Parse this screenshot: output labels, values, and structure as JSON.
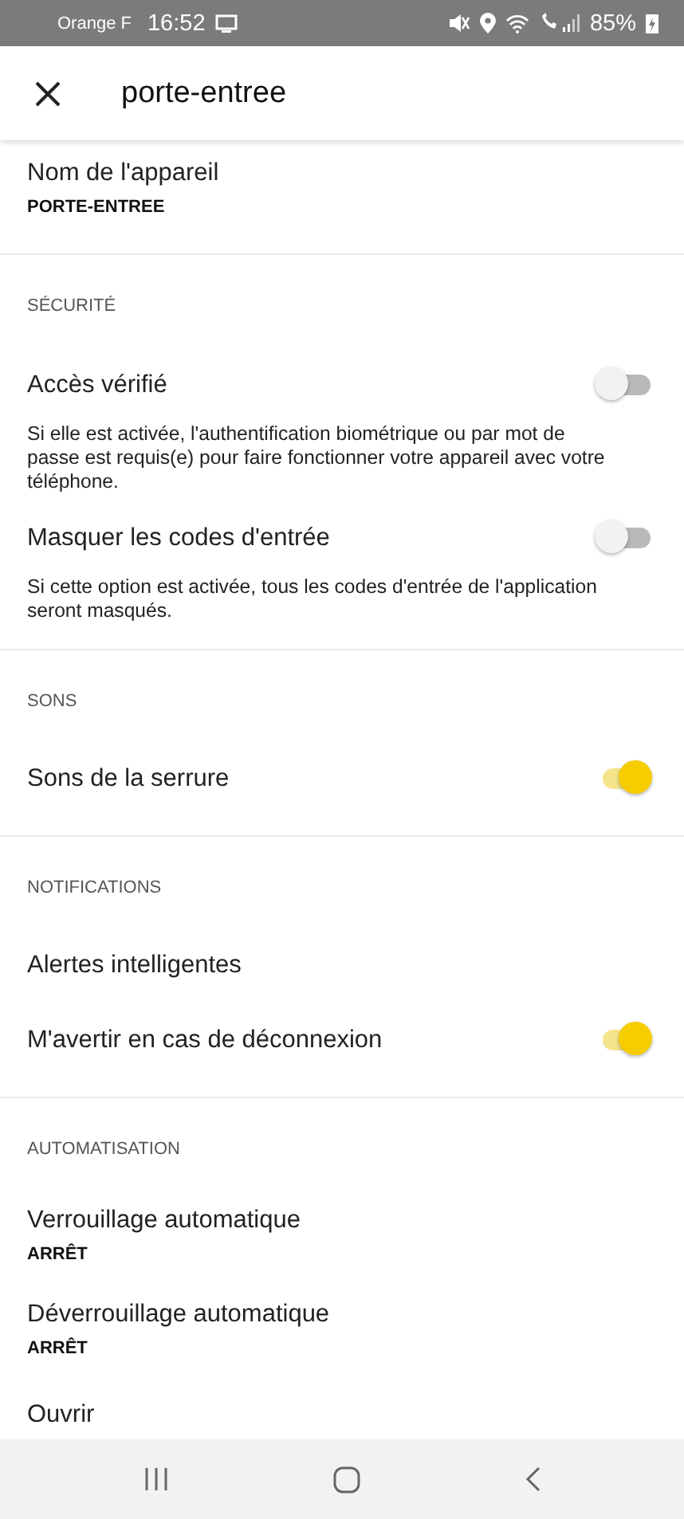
{
  "status_bar": {
    "carrier": "Orange F",
    "time": "16:52",
    "battery": "85%"
  },
  "header": {
    "title": "porte-entree"
  },
  "sections": [
    {
      "rows": [
        {
          "kind": "value",
          "label": "Nom de l'appareil",
          "value": "PORTE-ENTREE"
        }
      ]
    },
    {
      "title": "SÉCURITÉ",
      "rows": [
        {
          "kind": "toggle",
          "label": "Accès vérifié",
          "on": false,
          "description": "Si elle est activée, l'authentification biométrique ou par mot de passe est requis(e) pour faire fonctionner votre appareil avec votre téléphone."
        },
        {
          "kind": "toggle",
          "label": "Masquer les codes d'entrée",
          "on": false,
          "description": "Si cette option est activée, tous les codes d'entrée de l'application seront masqués."
        }
      ]
    },
    {
      "title": "SONS",
      "rows": [
        {
          "kind": "toggle",
          "label": "Sons de la serrure",
          "on": true
        }
      ]
    },
    {
      "title": "NOTIFICATIONS",
      "rows": [
        {
          "kind": "plain",
          "label": "Alertes intelligentes"
        },
        {
          "kind": "toggle",
          "label": "M'avertir en cas de déconnexion",
          "on": true
        }
      ]
    },
    {
      "title": "AUTOMATISATION",
      "rows": [
        {
          "kind": "value",
          "label": "Verrouillage automatique",
          "value": "ARRÊT"
        },
        {
          "kind": "value",
          "label": "Déverrouillage automatique",
          "value": "ARRÊT"
        },
        {
          "kind": "plain",
          "label": "Ouvrir"
        }
      ]
    }
  ]
}
